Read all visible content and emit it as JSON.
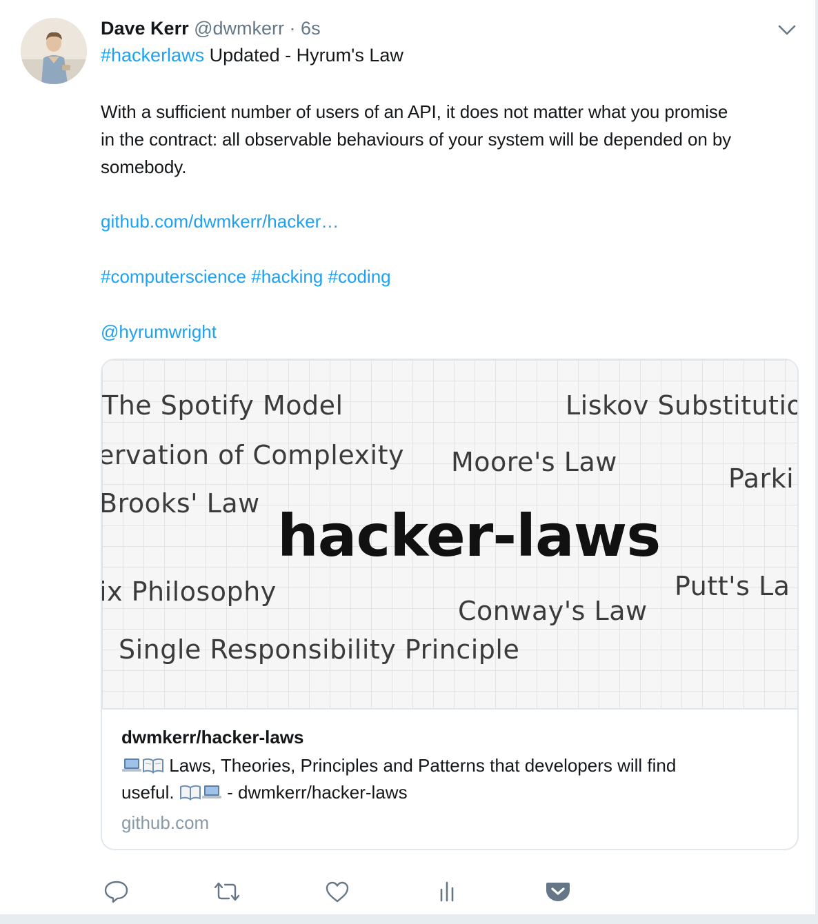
{
  "tweet": {
    "author_name": "Dave Kerr",
    "author_handle": "@dwmkerr",
    "separator": "·",
    "time": "6s",
    "hashtag": "#hackerlaws",
    "headline": "Updated - Hyrum's Law",
    "body_lines": [
      "With a sufficient number of users of an API, it does not matter what you promise",
      "in the contract: all observable behaviours of your system will be depended on by",
      "somebody."
    ],
    "url": "github.com/dwmkerr/hacker…",
    "hashtags": [
      "#computerscience",
      "#hacking",
      "#coding"
    ],
    "mention": "@hyrumwright"
  },
  "card": {
    "image_texts": {
      "title": "hacker-laws",
      "laws": [
        "The Spotify Model",
        "Liskov Substitutio",
        "ervation of Complexity",
        "Moore's Law",
        "Parki",
        "Brooks' Law",
        "ix Philosophy",
        "Putt's La",
        "Conway's Law",
        "Single Responsibility Principle"
      ]
    },
    "title": "dwmkerr/hacker-laws",
    "description_part1": "Laws, Theories, Principles and Patterns that developers will find",
    "description_part2": "useful.",
    "description_part3": "- dwmkerr/hacker-laws",
    "domain": "github.com"
  },
  "icons": {
    "avatar": "profile-photo",
    "menu": "chevron-down-icon",
    "reply": "reply-icon",
    "retweet": "retweet-icon",
    "like": "heart-icon",
    "analytics": "analytics-icon",
    "pocket": "pocket-icon",
    "emoji_laptop": "laptop-emoji",
    "emoji_book": "open-book-emoji"
  },
  "colors": {
    "link": "#1da1f2",
    "secondary_text": "#657786",
    "icon": "#657786",
    "pocket": "#657786"
  }
}
